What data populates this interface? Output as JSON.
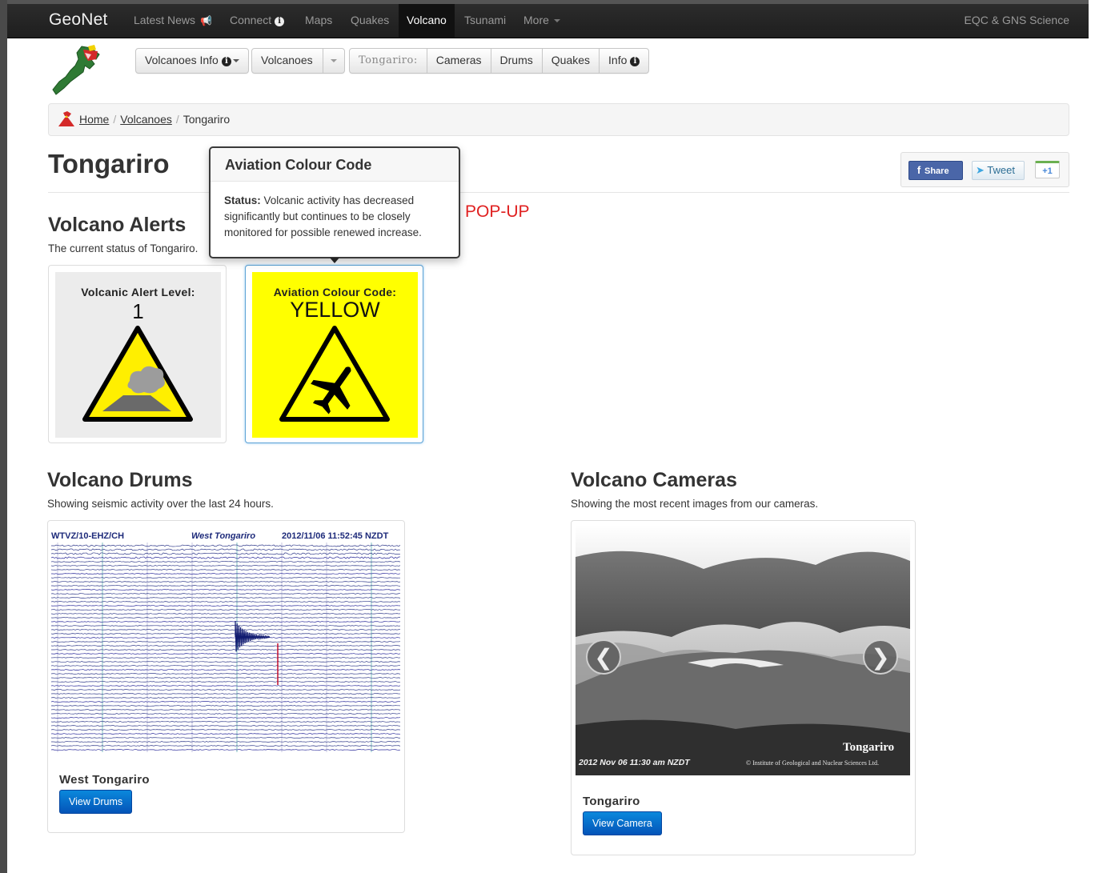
{
  "navbar": {
    "brand": "GeoNet",
    "items": [
      {
        "label": "Latest News"
      },
      {
        "label": "Connect"
      },
      {
        "label": "Maps"
      },
      {
        "label": "Quakes"
      },
      {
        "label": "Volcano",
        "active": true
      },
      {
        "label": "Tsunami"
      },
      {
        "label": "More"
      }
    ],
    "right_label": "EQC & GNS Science",
    "info_glyph": "i"
  },
  "subnav": {
    "volcanoes_info": "Volcanoes Info",
    "volcanoes": "Volcanoes",
    "current_volcano": "Tongariro:",
    "cameras": "Cameras",
    "drums": "Drums",
    "quakes": "Quakes",
    "info": "Info"
  },
  "breadcrumb": {
    "home": "Home",
    "volcanoes": "Volcanoes",
    "current": "Tongariro",
    "separator": "/"
  },
  "page": {
    "title": "Tongariro"
  },
  "social": {
    "share": "Share",
    "tweet": "Tweet",
    "plus_one": "+1",
    "fb_glyph": "f"
  },
  "alerts": {
    "heading": "Volcano Alerts",
    "subheading": "The current status of Tongariro.",
    "volcanic_alert": {
      "label": "Volcanic Alert Level:",
      "value": "1"
    },
    "aviation_code": {
      "label": "Aviation Colour Code:",
      "value": "YELLOW"
    }
  },
  "popover": {
    "title": "Aviation Colour Code",
    "status_label": "Status:",
    "status_text": "Volcanic activity has decreased significantly but continues to be closely monitored for possible renewed increase."
  },
  "annotation": {
    "text": "POP-UP"
  },
  "drums": {
    "heading": "Volcano Drums",
    "subheading": "Showing seismic activity over the last 24 hours.",
    "plot": {
      "station": "WTVZ/10-EHZ/CH",
      "location": "West Tongariro",
      "timestamp": "2012/11/06 11:52:45 NZDT"
    },
    "caption": "West Tongariro",
    "button": "View Drums"
  },
  "cameras": {
    "heading": "Volcano Cameras",
    "subheading": "Showing the most recent images from our cameras.",
    "image_timestamp": "2012 Nov 06 11:30 am NZDT",
    "image_location": "Tongariro",
    "image_copyright": "© Institute of Geological and Nuclear Sciences Ltd.",
    "caption": "Tongariro",
    "button": "View Camera",
    "prev_glyph": "❮",
    "next_glyph": "❯"
  },
  "colors": {
    "navbar_bg": "#222222",
    "primary_button": "#0a6fd0",
    "aviation_yellow": "#ffff00",
    "annotation_red": "#e02020",
    "seismo_blue": "#1d2a7a"
  }
}
